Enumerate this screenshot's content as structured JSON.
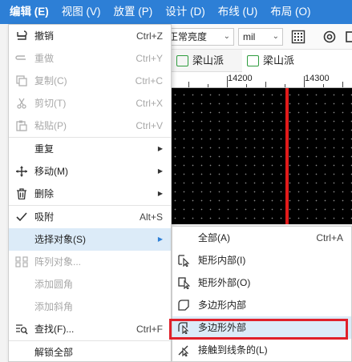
{
  "menubar": {
    "items": [
      {
        "label": "编辑 (E)",
        "active": true
      },
      {
        "label": "视图 (V)"
      },
      {
        "label": "放置 (P)"
      },
      {
        "label": "设计 (D)"
      },
      {
        "label": "布线 (U)"
      },
      {
        "label": "布局 (O)"
      }
    ]
  },
  "toolbar": {
    "brightness_value": "正常亮度",
    "unit_value": "mil"
  },
  "tabs": [
    {
      "label": "梁山派"
    },
    {
      "label": "梁山派"
    }
  ],
  "ruler": {
    "labels": [
      "14200",
      "14300"
    ]
  },
  "edit_menu": {
    "items": [
      {
        "label": "撤销",
        "shortcut": "Ctrl+Z",
        "icon": "undo-icon",
        "disabled": false
      },
      {
        "label": "重做",
        "shortcut": "Ctrl+Y",
        "icon": "redo-icon",
        "disabled": true
      },
      {
        "label": "复制(C)",
        "shortcut": "Ctrl+C",
        "icon": "copy-icon",
        "disabled": true
      },
      {
        "label": "剪切(T)",
        "shortcut": "Ctrl+X",
        "icon": "scissors-icon",
        "disabled": true
      },
      {
        "label": "粘贴(P)",
        "shortcut": "Ctrl+V",
        "icon": "paste-icon",
        "disabled": true
      },
      {
        "label": "重复",
        "shortcut": "",
        "icon": "",
        "disabled": false,
        "submenu": true
      },
      {
        "label": "移动(M)",
        "shortcut": "",
        "icon": "move-icon",
        "disabled": false,
        "submenu": true
      },
      {
        "label": "删除",
        "shortcut": "",
        "icon": "trash-icon",
        "disabled": false,
        "submenu": true
      },
      {
        "label": "吸附",
        "shortcut": "Alt+S",
        "icon": "check-icon",
        "disabled": false
      },
      {
        "label": "选择对象(S)",
        "shortcut": "",
        "icon": "",
        "disabled": false,
        "submenu": true,
        "highlighted": true
      },
      {
        "label": "阵列对象...",
        "shortcut": "",
        "icon": "grid-icon",
        "disabled": true
      },
      {
        "label": "添加圆角",
        "shortcut": "",
        "icon": "",
        "disabled": true
      },
      {
        "label": "添加斜角",
        "shortcut": "",
        "icon": "",
        "disabled": true
      },
      {
        "label": "查找(F)...",
        "shortcut": "Ctrl+F",
        "icon": "find-icon",
        "disabled": false
      },
      {
        "label": "解锁全部",
        "shortcut": "",
        "icon": "",
        "disabled": false
      }
    ]
  },
  "select_submenu": {
    "items": [
      {
        "label": "全部(A)",
        "shortcut": "Ctrl+A",
        "icon": ""
      },
      {
        "label": "矩形内部(I)",
        "shortcut": "",
        "icon": "rect-inside-icon"
      },
      {
        "label": "矩形外部(O)",
        "shortcut": "",
        "icon": "rect-outside-icon"
      },
      {
        "label": "多边形内部",
        "shortcut": "",
        "icon": "polygon-inside-icon"
      },
      {
        "label": "多边形外部",
        "shortcut": "",
        "icon": "polygon-outside-icon",
        "highlighted": true
      },
      {
        "label": "接触到线条的(L)",
        "shortcut": "",
        "icon": "line-touch-icon"
      }
    ]
  },
  "colors": {
    "accent": "#2d7fd6",
    "highlight": "#dcebf8",
    "callout": "#e0202a",
    "canvas": "#000000",
    "cursor_line": "#e21b1b"
  }
}
